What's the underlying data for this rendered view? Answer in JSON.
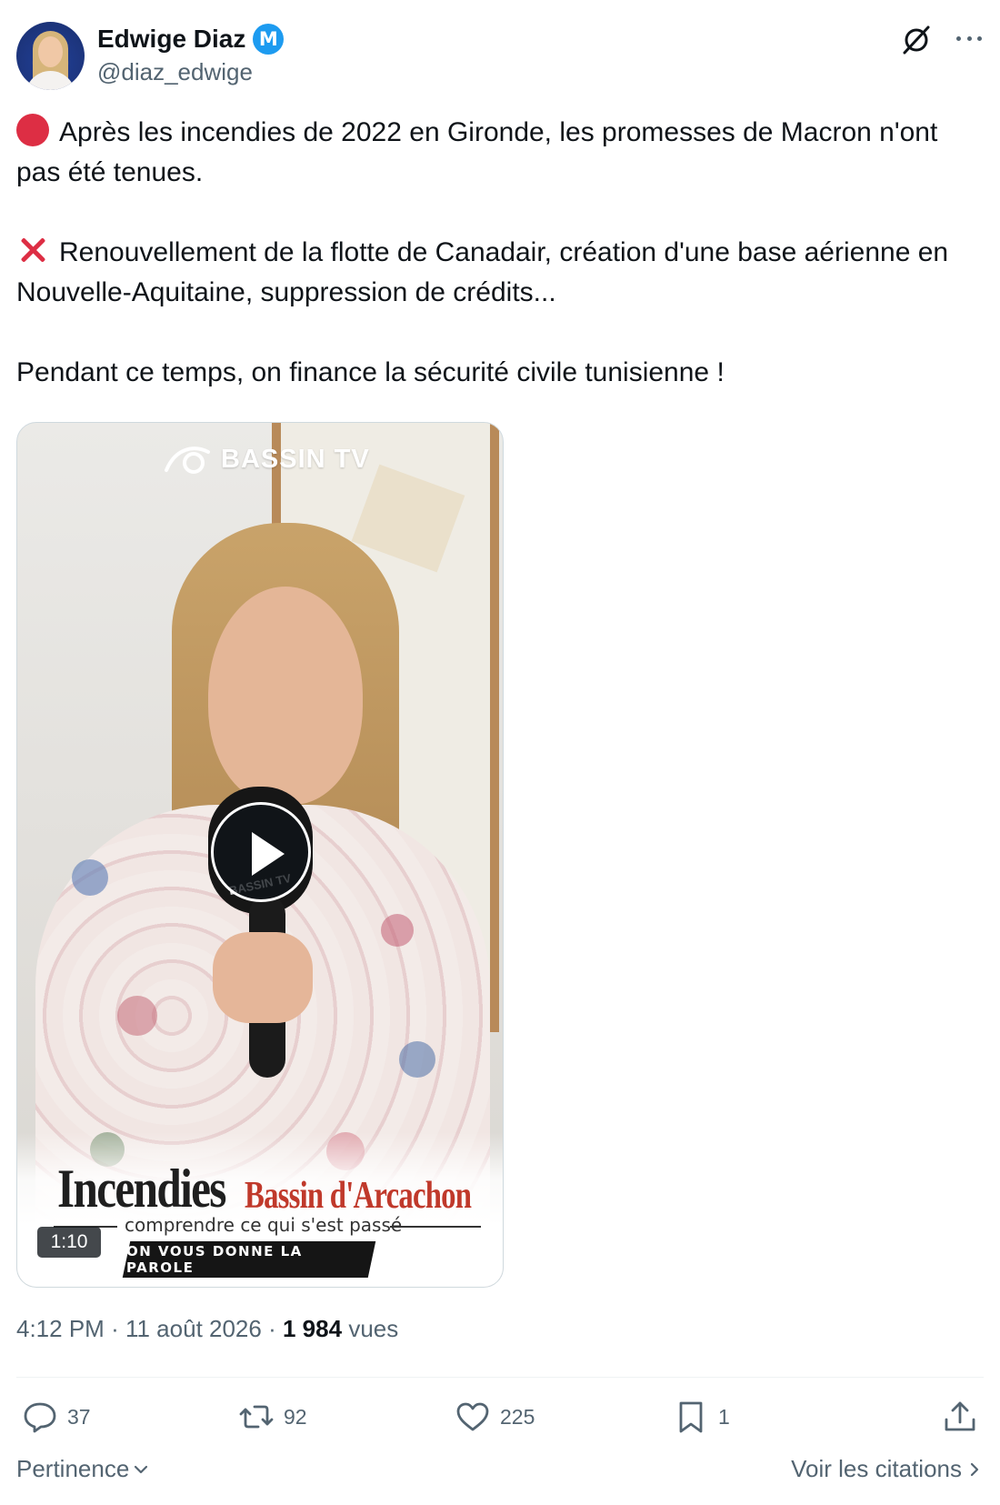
{
  "author": {
    "name": "Edwige Diaz",
    "verified_badge": "M",
    "handle": "@diaz_edwige"
  },
  "icons": {
    "grok": "grok-icon",
    "more": "more-icon"
  },
  "tweet": {
    "para1": "Après les incendies de 2022 en Gironde, les promesses de Macron n'ont pas été tenues.",
    "para2": "Renouvellement de la flotte de Canadair, création d'une base aérienne en Nouvelle-Aquitaine, suppression de crédits...",
    "para3": "Pendant ce temps, on finance la sécurité civile tunisienne !"
  },
  "video": {
    "brand": "BASSIN TV",
    "mic_label": "BASSIN TV",
    "overlay_title": "Incendies",
    "overlay_subtitle": "Bassin d'Arcachon",
    "overlay_caption": "comprendre ce qui s'est passé",
    "overlay_banner": "ON VOUS DONNE LA PAROLE",
    "duration": "1:10"
  },
  "meta": {
    "time": "4:12 PM",
    "sep1": "·",
    "date": "11 août 2026",
    "sep2": "·",
    "views_count": "1 984",
    "views_label": "vues"
  },
  "actions": {
    "replies": "37",
    "reposts": "92",
    "likes": "225",
    "bookmarks": "1"
  },
  "footer": {
    "sort_label": "Pertinence",
    "quotes_label": "Voir les citations"
  },
  "colors": {
    "accent": "#1d9bf0",
    "text": "#0f1419",
    "secondary": "#536471",
    "emoji_red": "#dd2e44"
  }
}
